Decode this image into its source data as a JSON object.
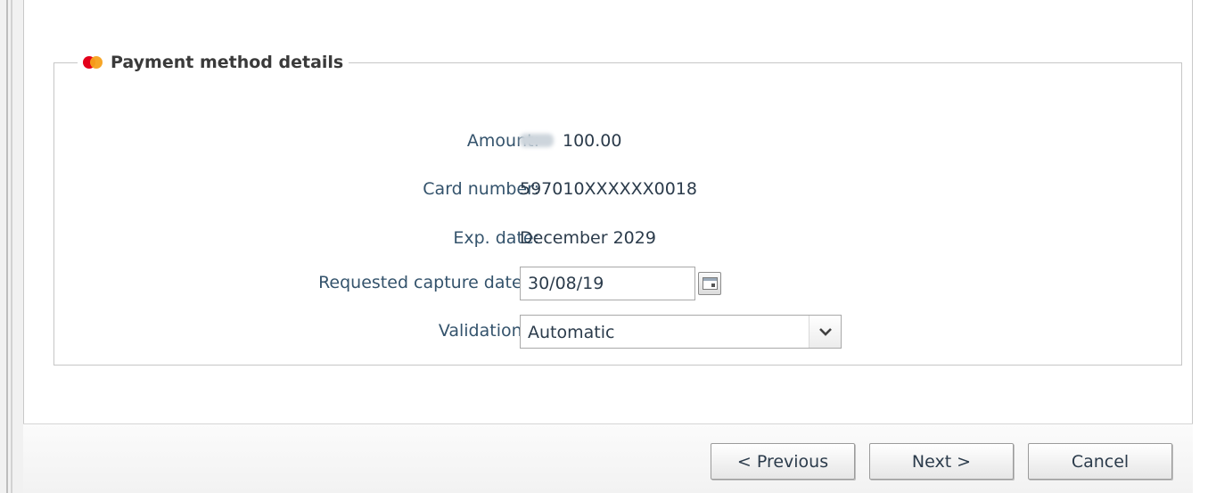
{
  "section": {
    "legend": "Payment method details"
  },
  "fields": {
    "amount": {
      "label": "Amount:",
      "value": "100.00"
    },
    "card_number": {
      "label": "Card number:",
      "value": "597010XXXXXX0018"
    },
    "exp_date": {
      "label": "Exp. date:",
      "value": "December 2029"
    },
    "capture_date": {
      "label": "Requested capture date",
      "required_mark": "*",
      "suffix": ":",
      "value": "30/08/19"
    },
    "validation": {
      "label": "Validation",
      "required_mark": "*",
      "suffix": ":",
      "selected": "Automatic"
    }
  },
  "buttons": {
    "previous": "< Previous",
    "next": "Next >",
    "cancel": "Cancel"
  },
  "icons": {
    "card_brand": "mastercard-icon",
    "calendar": "calendar-icon",
    "dropdown": "chevron-down-icon"
  },
  "colors": {
    "label": "#34536c",
    "required": "#e23c3c",
    "mastercard_red": "#e3001b",
    "mastercard_orange": "#f7a11b"
  }
}
